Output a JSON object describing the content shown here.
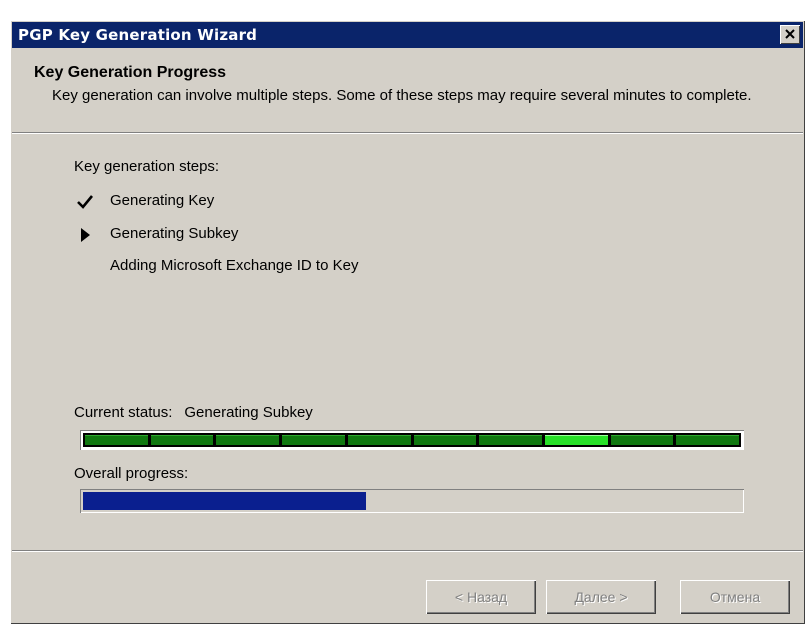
{
  "window": {
    "title": "PGP Key Generation Wizard",
    "close_icon": "close-icon",
    "colors": {
      "titlebar": "#0a246a",
      "face": "#d4d0c8",
      "segment": "#107810",
      "segment_active": "#28e028",
      "progress": "#0a1f8f"
    }
  },
  "header": {
    "title": "Key Generation Progress",
    "description": "Key generation can involve multiple steps.  Some of these steps may require several minutes to complete."
  },
  "steps": {
    "label": "Key generation steps:",
    "items": [
      {
        "label": "Generating Key",
        "state": "done",
        "icon": "checkmark-icon"
      },
      {
        "label": "Generating Subkey",
        "state": "current",
        "icon": "arrow-right-icon"
      },
      {
        "label": "Adding Microsoft Exchange ID to Key",
        "state": "pending",
        "icon": ""
      }
    ]
  },
  "status": {
    "label": "Current status:",
    "value": "Generating Subkey",
    "segments_total": 10,
    "active_segment": 8
  },
  "overall": {
    "label": "Overall progress:",
    "progress": 0.43
  },
  "buttons": {
    "back": "< Назад",
    "next": "Далее >",
    "cancel": "Отмена",
    "enabled": false
  }
}
